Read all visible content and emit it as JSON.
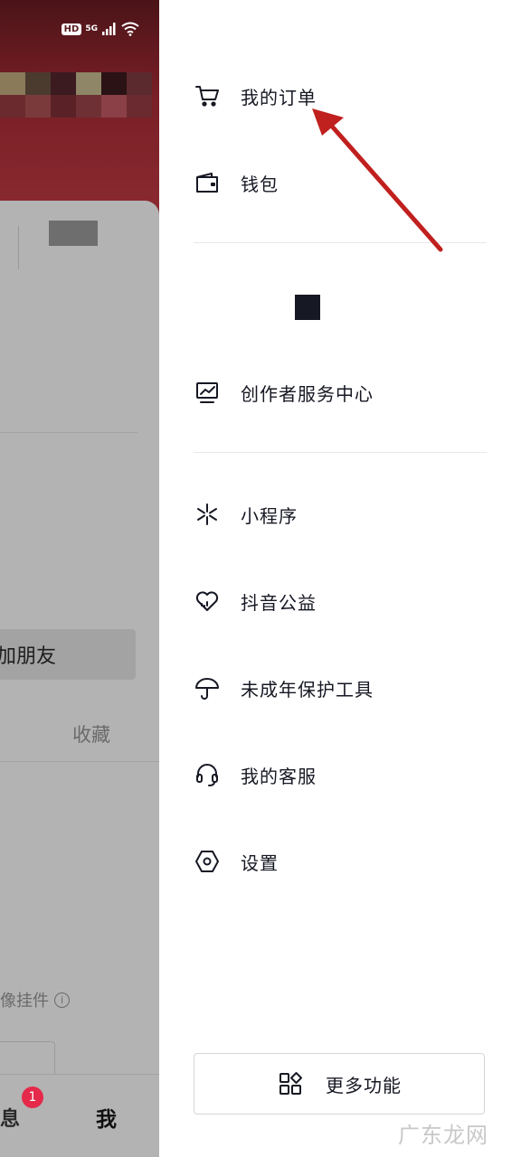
{
  "status_bar": {
    "hd": "HD",
    "net": "5G"
  },
  "background_page": {
    "add_friend_label": "加朋友",
    "collect_tab": "收藏",
    "widget_label": "像挂件",
    "info_glyph": "i",
    "tab_message": "消息",
    "tab_message_visible": "息",
    "message_badge": "1",
    "tab_me": "我"
  },
  "drawer": {
    "items": [
      {
        "label": "我的订单",
        "icon": "cart-icon"
      },
      {
        "label": "钱包",
        "icon": "wallet-icon"
      },
      {
        "label": "创作者服务中心",
        "icon": "creator-chart-icon"
      },
      {
        "label": "小程序",
        "icon": "mini-program-icon"
      },
      {
        "label": "抖音公益",
        "icon": "charity-heart-icon"
      },
      {
        "label": "未成年保护工具",
        "icon": "umbrella-icon"
      },
      {
        "label": "我的客服",
        "icon": "headset-icon"
      },
      {
        "label": "设置",
        "icon": "settings-hexagon-icon"
      }
    ],
    "more_button": {
      "label": "更多功能",
      "icon": "grid-apps-icon"
    }
  },
  "watermark": "广东龙网",
  "annotation": {
    "color": "#c0201e"
  },
  "colors": {
    "text": "#161823",
    "divider": "#e8e8ea",
    "badge": "#e5294a"
  }
}
